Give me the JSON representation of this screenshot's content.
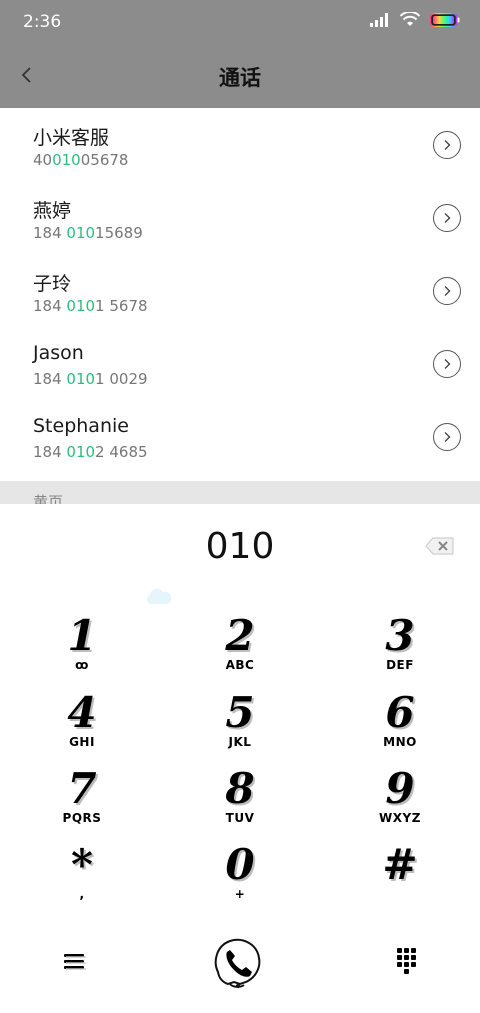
{
  "status_bar": {
    "time": "2:36",
    "icons": [
      "signal-icon",
      "wifi-icon",
      "battery-icon"
    ]
  },
  "header": {
    "title": "通话",
    "back_icon": "chevron-left-icon",
    "background": "#8c8c8c"
  },
  "contacts": [
    {
      "name": "小米客服",
      "number_pre": "40",
      "number_match": "010",
      "number_post": "05678"
    },
    {
      "name": "燕婷",
      "number_pre": "184 ",
      "number_match": "010",
      "number_post": "15689"
    },
    {
      "name": "子玲",
      "number_pre": "184 ",
      "number_match": "010",
      "number_post": "1 5678"
    },
    {
      "name": "Jason",
      "number_pre": "184 ",
      "number_match": "010",
      "number_post": "1 0029"
    },
    {
      "name": "Stephanie",
      "number_pre": "184 ",
      "number_match": "010",
      "number_post": "2 4685"
    }
  ],
  "section_label": "黄页",
  "dialpad": {
    "input": "010",
    "keys": [
      {
        "digit": "1",
        "letters": "ꝏ"
      },
      {
        "digit": "2",
        "letters": "ABC"
      },
      {
        "digit": "3",
        "letters": "DEF"
      },
      {
        "digit": "4",
        "letters": "GHI"
      },
      {
        "digit": "5",
        "letters": "JKL"
      },
      {
        "digit": "6",
        "letters": "MNO"
      },
      {
        "digit": "7",
        "letters": "PQRS"
      },
      {
        "digit": "8",
        "letters": "TUV"
      },
      {
        "digit": "9",
        "letters": "WXYZ"
      },
      {
        "digit": "*",
        "letters": ","
      },
      {
        "digit": "0",
        "letters": "+"
      },
      {
        "digit": "#",
        "letters": ""
      }
    ]
  },
  "colors": {
    "highlight": "#2bbd7e",
    "header_bg": "#8c8c8c",
    "section_bg": "#e6e6e6"
  }
}
